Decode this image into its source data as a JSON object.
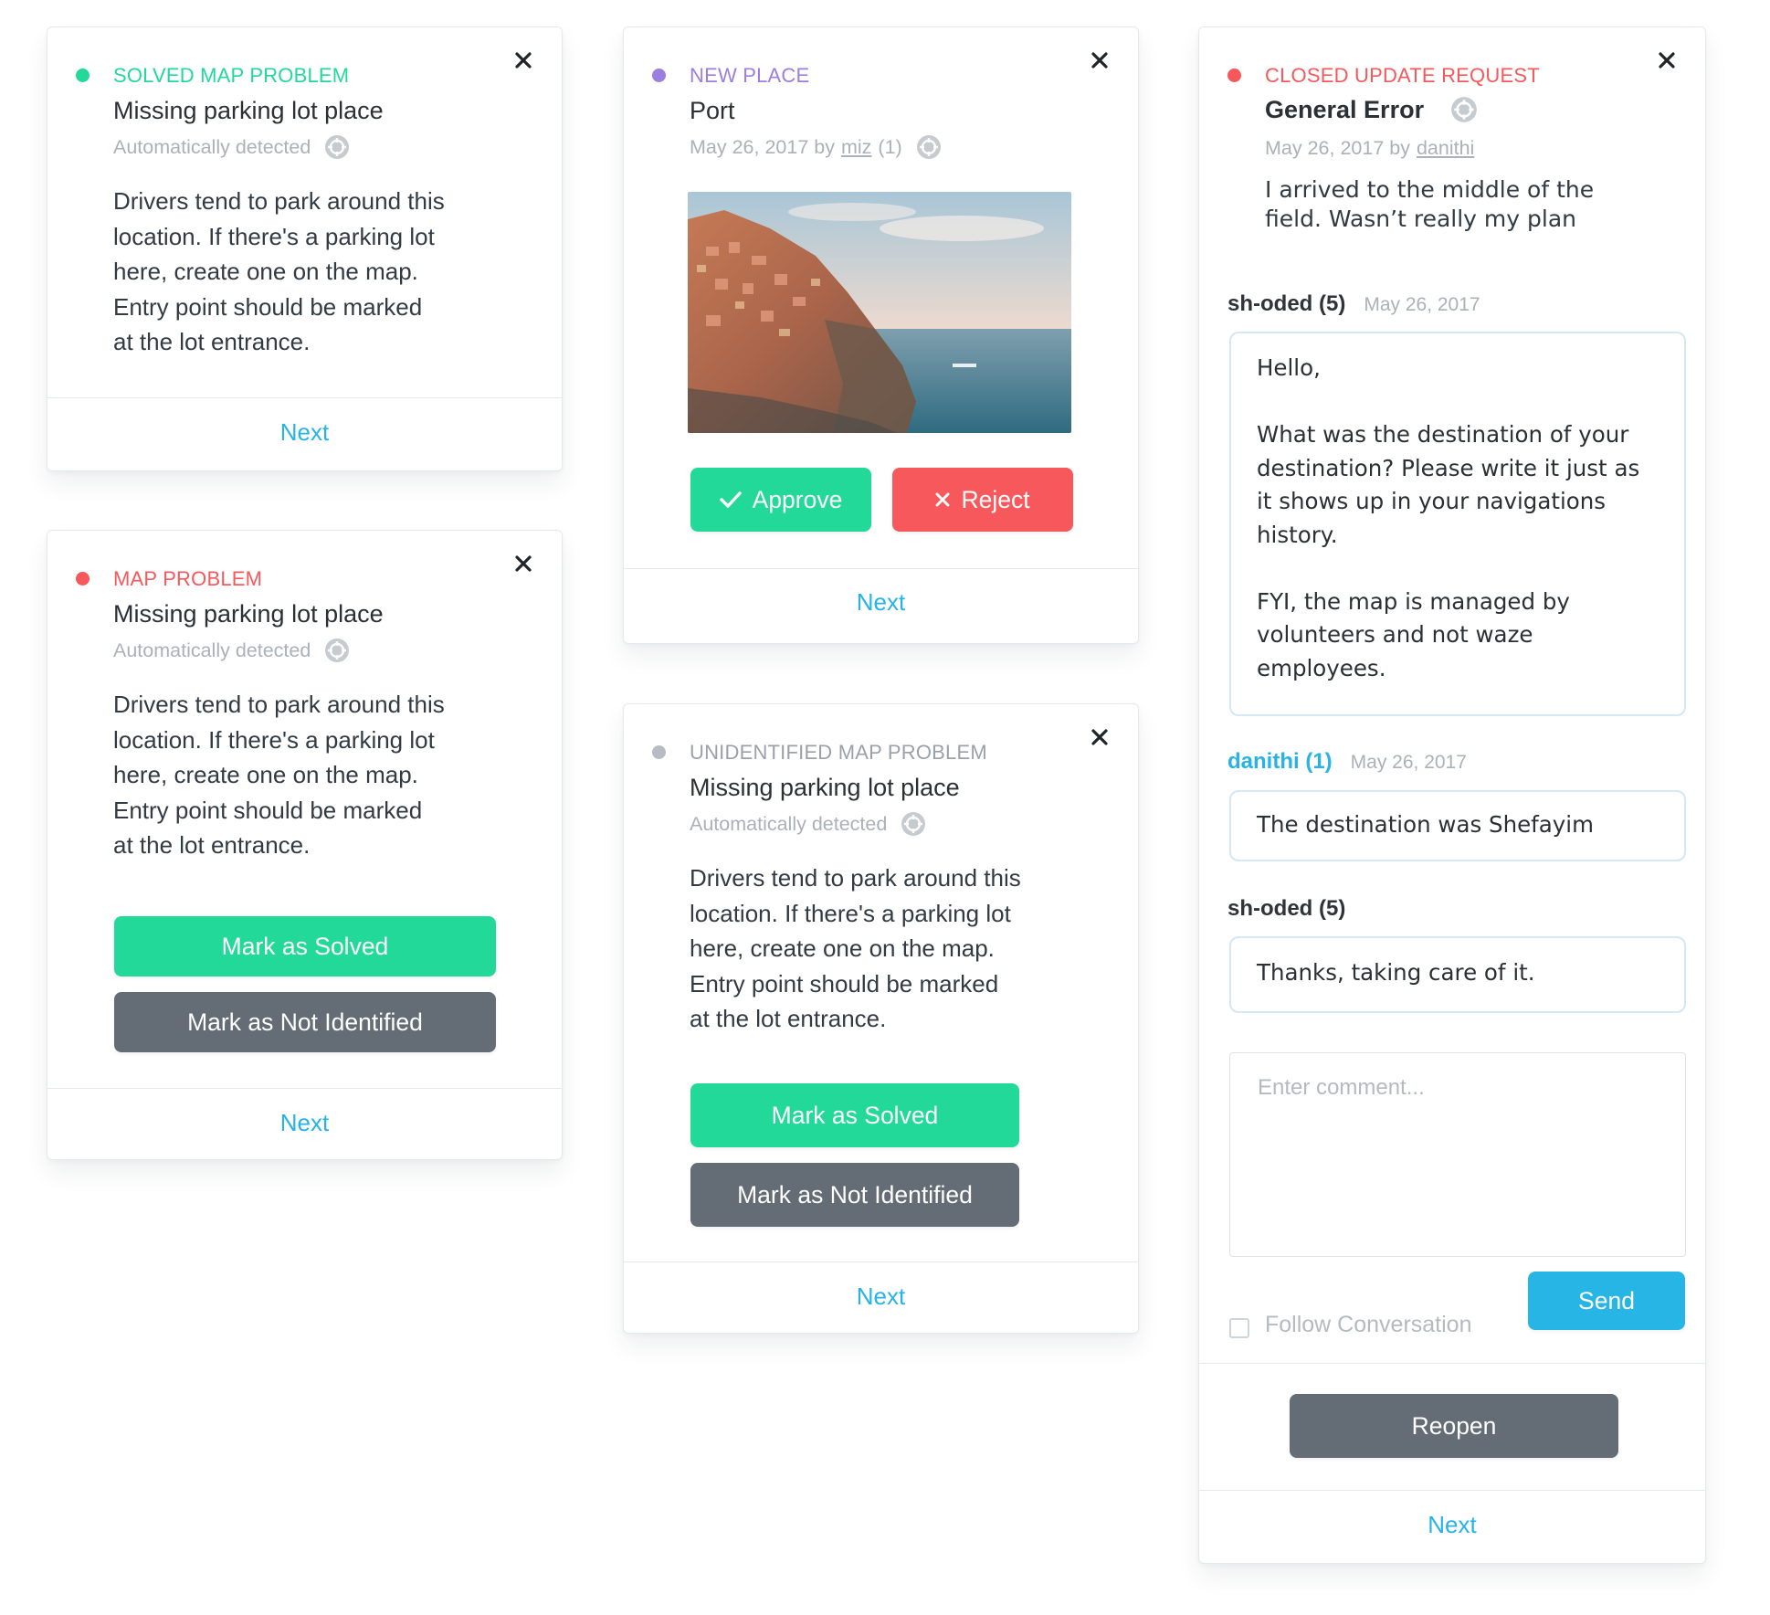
{
  "colors": {
    "solved": "#22d99a",
    "problem": "#f7585c",
    "new_place": "#9b7ee0",
    "unidentified": "#b6bcc2",
    "link": "#27b3e7",
    "gray_button": "#646d75"
  },
  "icons": {
    "close": "close-icon",
    "target": "target-icon",
    "check": "check-icon"
  },
  "cards": {
    "solved": {
      "kind": "SOLVED MAP PROBLEM",
      "title": "Missing parking lot place",
      "meta": "Automatically detected",
      "desc": [
        "Drivers tend to park around this",
        "location. If there's a parking lot",
        "here, create one on the map.",
        "Entry point should be marked",
        "at the lot entrance."
      ],
      "next": "Next"
    },
    "problem": {
      "kind": "MAP PROBLEM",
      "title": "Missing parking lot place",
      "meta": "Automatically detected",
      "desc": [
        "Drivers tend to park around this",
        "location. If there's a parking lot",
        "here, create one on the map.",
        "Entry point should be marked",
        "at the lot entrance."
      ],
      "solve_button": "Mark as Solved",
      "not_identified_button": "Mark as Not Identified",
      "next": "Next"
    },
    "new_place": {
      "kind": "NEW PLACE",
      "title": "Port",
      "date": "May 26, 2017 by",
      "user": "miz",
      "user_rank": "(1)",
      "approve": "Approve",
      "reject": "Reject",
      "next": "Next"
    },
    "unidentified": {
      "kind": "UNIDENTIFIED MAP PROBLEM",
      "title": "Missing parking lot place",
      "meta": "Automatically detected",
      "desc": [
        "Drivers tend to park around this",
        "location. If there's a parking lot",
        "here, create one on the map.",
        "Entry point should be marked",
        "at the lot entrance."
      ],
      "solve_button": "Mark as Solved",
      "not_identified_button": "Mark as Not Identified",
      "next": "Next"
    },
    "closed": {
      "kind": "CLOSED UPDATE REQUEST",
      "title": "General Error",
      "date": "May 26, 2017 by",
      "user": "danithi",
      "desc": [
        "I arrived to the middle of the",
        "field. Wasn’t really my plan"
      ],
      "comments": [
        {
          "author": "sh-oded (5)",
          "date": "May 26, 2017",
          "paragraphs": [
            [
              "Hello,"
            ],
            [
              "What was the destination of your",
              "destination? Please write it just as",
              "it shows up in your navigations",
              "history."
            ],
            [
              "FYI, the map is managed by",
              "volunteers and not waze",
              "employees."
            ]
          ]
        },
        {
          "author": "danithi (1)",
          "date": "May 26, 2017",
          "text": "The destination was Shefayim"
        },
        {
          "author": "sh-oded (5)",
          "date": "",
          "text": "Thanks, taking care of it."
        }
      ],
      "comment_placeholder": "Enter comment...",
      "follow_label": "Follow Conversation",
      "send": "Send",
      "reopen": "Reopen",
      "next": "Next"
    }
  }
}
